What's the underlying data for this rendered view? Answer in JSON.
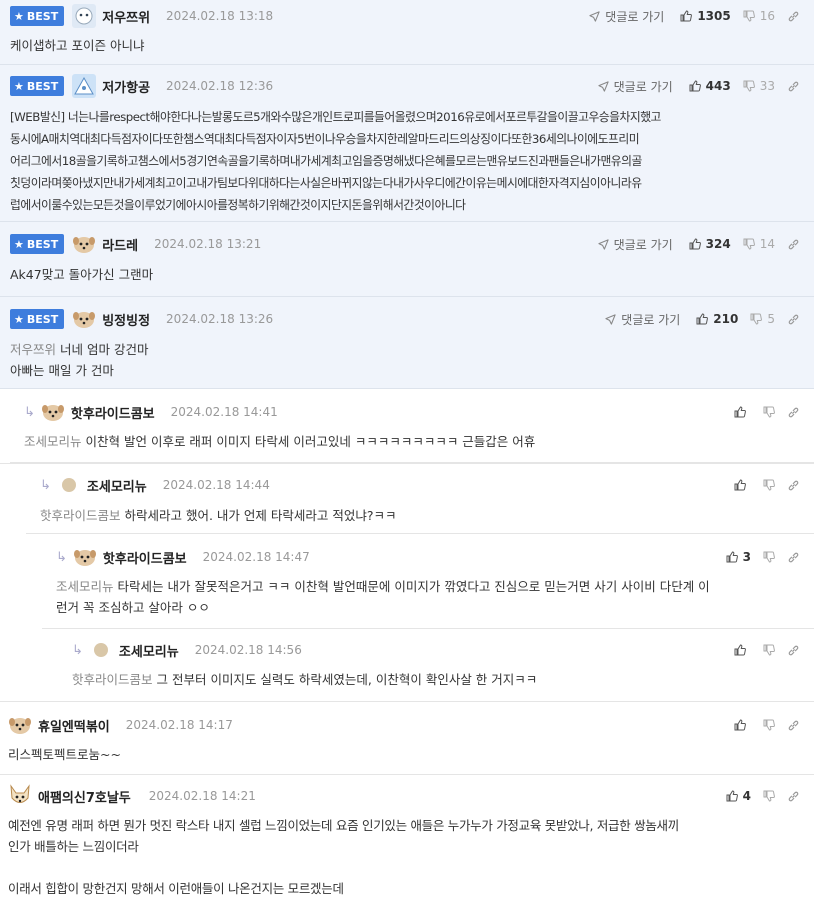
{
  "colors": {
    "accent": "#3e7ddd",
    "best_bg": "#f0f4fb"
  },
  "labels": {
    "best": "BEST",
    "goto": "댓글로 가기",
    "reply_icon": "reply-arrow-icon",
    "up_icon": "thumbs-up-icon",
    "down_icon": "thumbs-down-icon",
    "link_icon": "link-icon"
  },
  "comments": [
    {
      "nick": "저우쯔위",
      "date": "2024.02.18 13:18",
      "up": "1305",
      "down": "16",
      "lines": [
        "케이샙하고 포이즌 아니냐"
      ]
    },
    {
      "nick": "저가항공",
      "date": "2024.02.18 12:36",
      "up": "443",
      "down": "33",
      "lines": [
        "[WEB발신] 너는나를respect해야한다나는발롱도르5개와수많은개인트로피를들어올렸으며2016유로에서포르투갈을이끌고우승을차지했고",
        "동시에A매치역대최다득점자이다또한챔스역대최다득점자이자5번이나우승을차지한레알마드리드의상징이다또한36세의나이에도프리미",
        "어리그에서18골을기록하고챔스에서5경기연속골을기록하며내가세계최고임을증명해냈다은혜를모르는맨유보드진과팬들은내가맨유의골",
        "칫덩이라며쫒아냈지만내가세계최고이고내가팀보다위대하다는사실은바뀌지않는다내가사우디에간이유는메시에대한자격지심이아니라유",
        "럽에서이룰수있는모든것을이루었기에아시아를정복하기위해간것이지단지돈을위해서간것이아니다"
      ]
    },
    {
      "nick": "라드레",
      "date": "2024.02.18 13:21",
      "up": "324",
      "down": "14",
      "lines": [
        "Ak47맞고 돌아가신 그랜마"
      ]
    },
    {
      "nick": "빙정빙정",
      "date": "2024.02.18 13:26",
      "up": "210",
      "down": "5",
      "mention": "저우쯔위",
      "lines": [
        "너네 엄마 강건마",
        "아빠는 매일 가 건마"
      ]
    }
  ],
  "replies": [
    {
      "nick": "핫후라이드콤보",
      "date": "2024.02.18 14:41",
      "mention": "조세모리뉴",
      "up": "",
      "lines": [
        "이찬혁 발언 이후로 래퍼 이미지 타락세 이러고있네 ㅋㅋㅋㅋㅋㅋㅋㅋㅋ 근들갑은 어휴"
      ]
    },
    {
      "nick": "조세모리뉴",
      "date": "2024.02.18 14:44",
      "mention": "핫후라이드콤보",
      "up": "",
      "lines": [
        "하락세라고 했어. 내가 언제 타락세라고 적었냐?ㅋㅋ"
      ]
    },
    {
      "nick": "핫후라이드콤보",
      "date": "2024.02.18 14:47",
      "mention": "조세모리뉴",
      "up": "3",
      "lines": [
        "타락세는 내가 잘못적은거고 ㅋㅋ 이찬혁 발언때문에 이미지가 깎였다고 진심으로 믿는거면 사기 사이비 다단계 이",
        "런거 꼭 조심하고 살아라 ㅇㅇ"
      ]
    },
    {
      "nick": "조세모리뉴",
      "date": "2024.02.18 14:56",
      "mention": "핫후라이드콤보",
      "up": "",
      "lines": [
        "그 전부터 이미지도 실력도 하락세였는데, 이찬혁이 확인사살 한 거지ㅋㅋ"
      ]
    }
  ],
  "normal": [
    {
      "nick": "휴일엔떡볶이",
      "date": "2024.02.18 14:17",
      "up": "",
      "lines": [
        "리스펙토펙트로눔~~"
      ]
    },
    {
      "nick": "애팸의신7호날두",
      "date": "2024.02.18 14:21",
      "up": "4",
      "lines": [
        "예전엔 유명 래퍼 하면 뭔가 멋진 락스타 내지 셀럽 느낌이었는데 요즘 인기있는 애들은 누가누가 가정교육 못받았나, 저급한 쌍놈새끼",
        "인가 배틀하는 느낌이더라",
        "",
        "이래서 힙합이 망한건지 망해서 이런애들이 나온건지는 모르겠는데"
      ]
    }
  ]
}
